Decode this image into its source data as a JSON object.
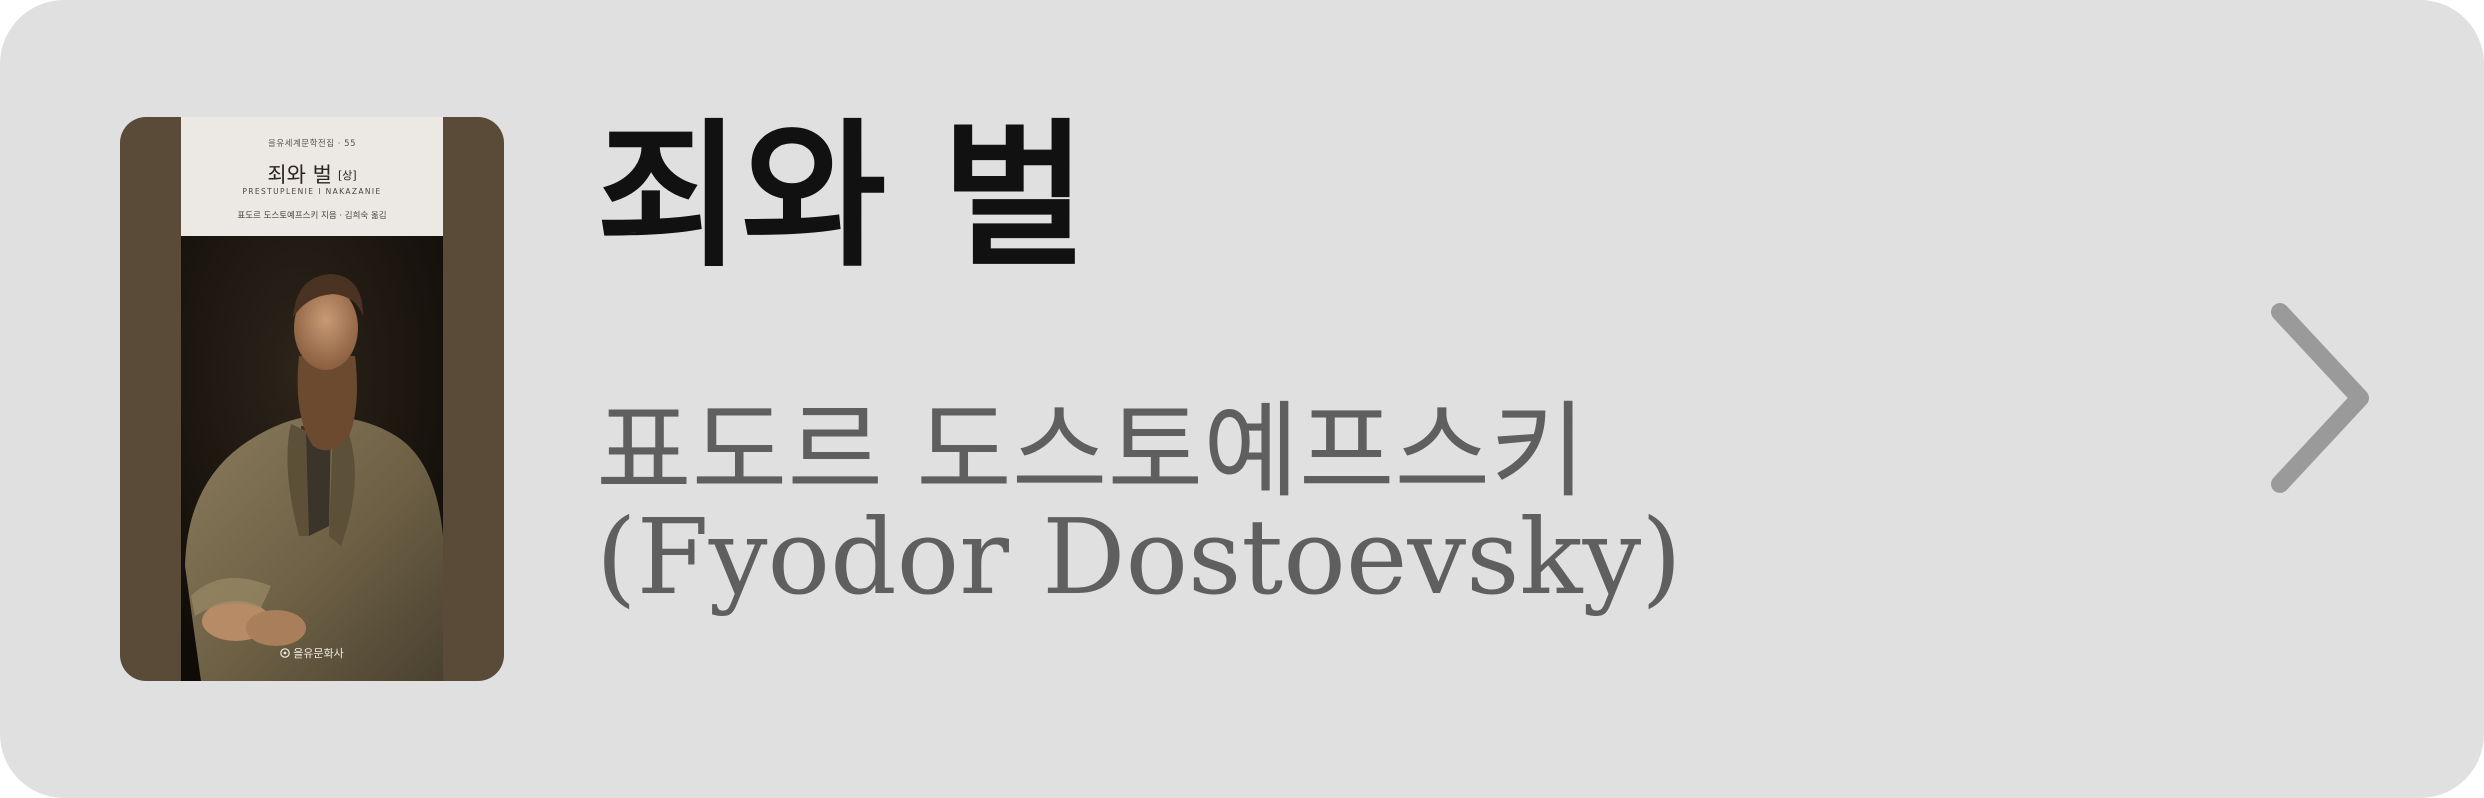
{
  "book": {
    "title": "죄와 벌",
    "author_korean": "표도르 도스토예프스키",
    "author_english": "(Fyodor Dostoevsky)"
  },
  "cover": {
    "series": "을유세계문학전집 · 55",
    "title": "죄와 벌",
    "volume": "[상]",
    "latin_title": "PRESTUPLENIE I NAKAZANIE",
    "credit": "표도르 도스토예프스키 지음 · 김희숙 옮김",
    "publisher": "을유문화사"
  },
  "chevron_icon": "chevron-right-icon",
  "colors": {
    "card_background": "#e0e0e0",
    "title": "#111111",
    "author": "#5f5f5f",
    "chevron": "#9a9a9a",
    "cover_frame": "#5a4b38"
  }
}
